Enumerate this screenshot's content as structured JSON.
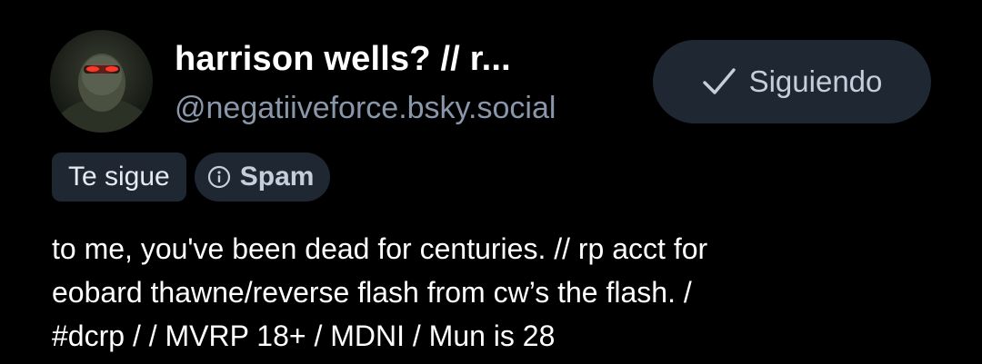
{
  "profile": {
    "display_name": "harrison wells? // r...",
    "handle": "@negatiiveforce.bsky.social",
    "avatar_icon": "masked-figure-avatar"
  },
  "follow_button": {
    "label": "Siguiendo",
    "icon": "check-icon"
  },
  "badges": {
    "follows_you": "Te sigue",
    "spam_label": "Spam",
    "spam_icon": "info-icon"
  },
  "bio": {
    "lines": [
      "to me, you've been dead for centuries. // rp acct for",
      "eobard thawne/reverse flash from cw’s the flash. /",
      "#dcrp / / MVRP 18+ / MDNI / Mun is 28"
    ]
  },
  "colors": {
    "background": "#000000",
    "button_bg": "#1f2733",
    "handle_text": "#8a97ab",
    "button_text": "#c5cfdb",
    "primary_text": "#ffffff"
  }
}
